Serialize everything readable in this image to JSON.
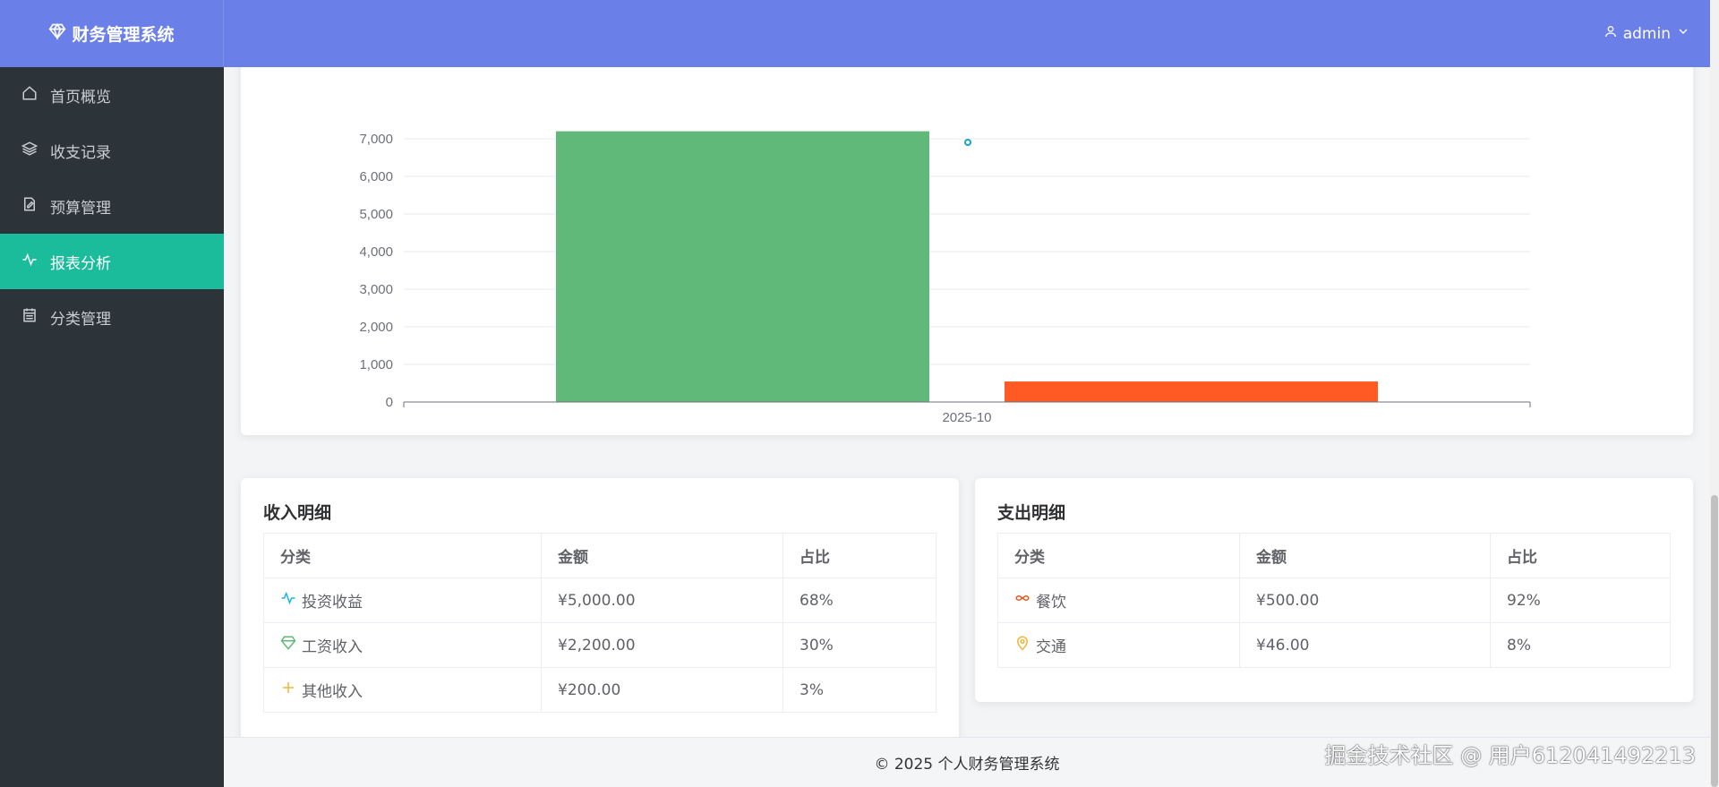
{
  "app": {
    "title": "财务管理系统"
  },
  "header": {
    "user": "admin"
  },
  "sidebar": {
    "items": [
      {
        "label": "首页概览",
        "icon": "home-icon"
      },
      {
        "label": "收支记录",
        "icon": "layers-icon"
      },
      {
        "label": "预算管理",
        "icon": "edit-document-icon"
      },
      {
        "label": "报表分析",
        "icon": "activity-icon",
        "active": true
      },
      {
        "label": "分类管理",
        "icon": "calendar-list-icon"
      }
    ]
  },
  "chart_data": {
    "type": "bar",
    "categories": [
      "2025-10"
    ],
    "series": [
      {
        "values": [
          7200
        ],
        "color": "#61b979"
      },
      {
        "values": [
          546
        ],
        "color": "#ff5a24"
      }
    ],
    "ylim": [
      0,
      7000
    ],
    "yticks": [
      0,
      1000,
      2000,
      3000,
      4000,
      5000,
      6000,
      7000
    ],
    "ytick_labels": [
      "0",
      "1,000",
      "2,000",
      "3,000",
      "4,000",
      "5,000",
      "6,000",
      "7,000"
    ],
    "grid": true
  },
  "income": {
    "title": "收入明细",
    "headers": [
      "分类",
      "金额",
      "占比"
    ],
    "rows": [
      {
        "category": "投资收益",
        "amount": "¥5,000.00",
        "percent": "68%",
        "icon": "activity-icon",
        "color": "#1cb5e0"
      },
      {
        "category": "工资收入",
        "amount": "¥2,200.00",
        "percent": "30%",
        "icon": "diamond-icon",
        "color": "#5fb878"
      },
      {
        "category": "其他收入",
        "amount": "¥200.00",
        "percent": "3%",
        "icon": "plus-icon",
        "color": "#f0b63a"
      }
    ]
  },
  "expense": {
    "title": "支出明细",
    "headers": [
      "分类",
      "金额",
      "占比"
    ],
    "rows": [
      {
        "category": "餐饮",
        "amount": "¥500.00",
        "percent": "92%",
        "icon": "link-icon",
        "color": "#e8581c"
      },
      {
        "category": "交通",
        "amount": "¥46.00",
        "percent": "8%",
        "icon": "location-icon",
        "color": "#f0b63a"
      }
    ]
  },
  "footer": {
    "text": "© 2025 个人财务管理系统"
  },
  "watermark": "掘金技术社区 @ 用户612041492213"
}
